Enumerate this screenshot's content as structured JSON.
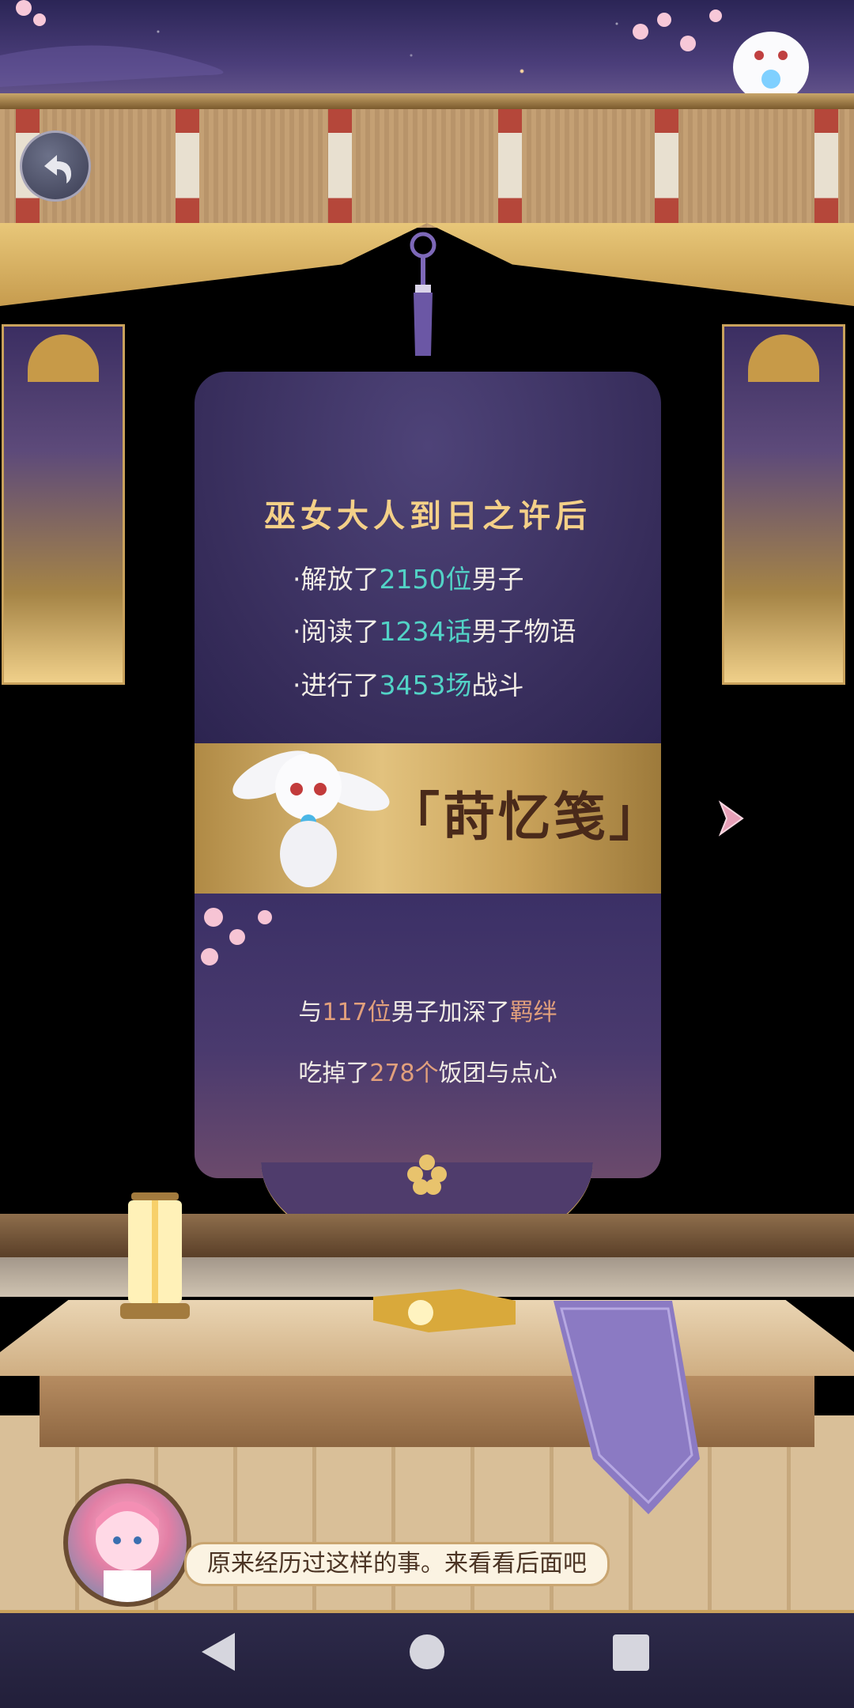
{
  "card": {
    "title": "巫女大人到日之许后",
    "stats_top": [
      {
        "prefix": "·解放了",
        "value": "2150位",
        "suffix": "男子"
      },
      {
        "prefix": "·阅读了",
        "value": "1234话",
        "suffix": "男子物语"
      },
      {
        "prefix": "·进行了",
        "value": "3453场",
        "suffix": "战斗"
      }
    ],
    "ribbon_title": "「莳忆笺」",
    "stats_bottom": [
      {
        "prefix": "与",
        "value": "117位",
        "middle": "男子加深了",
        "value2": "羁绊"
      },
      {
        "prefix": "吃掉了",
        "value": "278个",
        "middle": "饭团与点心",
        "value2": ""
      }
    ]
  },
  "dialog": {
    "text": "原来经历过这样的事。来看看后面吧"
  },
  "icons": {
    "back": "back-arrow-icon",
    "next": "chevron-right-icon",
    "nav_back": "triangle-back-icon",
    "nav_home": "circle-home-icon",
    "nav_recent": "square-recent-icon"
  },
  "colors": {
    "highlight_teal": "#52d3c6",
    "highlight_peach": "#e2a07c",
    "title_gold": "#f4d088",
    "card_purple": "#372d5b"
  }
}
